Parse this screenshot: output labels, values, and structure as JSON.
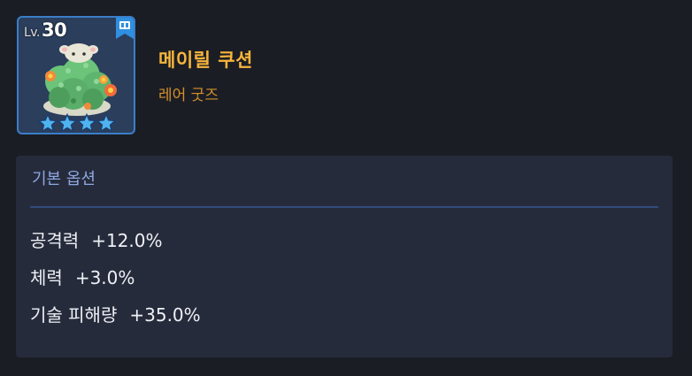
{
  "item": {
    "level_prefix": "Lv.",
    "level": "30",
    "name": "메이릴 쿠션",
    "grade": "레어 굿즈",
    "stars": 4,
    "icons": {
      "bookmark": "bookmark-icon",
      "star": "star-icon",
      "item": "cushion-item-icon"
    },
    "colors": {
      "name": "#f7b53c",
      "grade": "#d4902a",
      "frame": "#3a7ec8",
      "star": "#4fb3f0"
    }
  },
  "options": {
    "title": "기본 옵션",
    "stats": [
      {
        "label": "공격력",
        "value": "+12.0%"
      },
      {
        "label": "체력",
        "value": "+3.0%"
      },
      {
        "label": "기술 피해량",
        "value": "+35.0%"
      }
    ]
  }
}
